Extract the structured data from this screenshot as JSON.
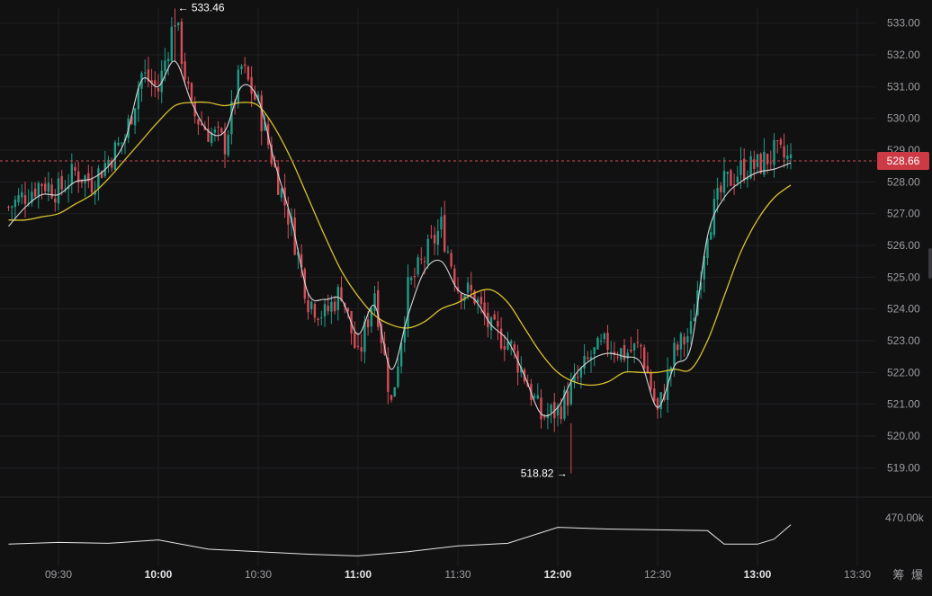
{
  "chart_data": {
    "type": "candlestick",
    "symbol": "",
    "title": "",
    "last_price": 528.66,
    "high_marker": {
      "value": 533.46,
      "time": "10:05",
      "label": "533.46"
    },
    "low_marker": {
      "value": 518.82,
      "time": "12:04",
      "label": "518.82"
    },
    "y_axis": {
      "min": 518.5,
      "max": 533.5,
      "ticks": [
        "533.00",
        "532.00",
        "531.00",
        "530.00",
        "529.00",
        "528.00",
        "527.00",
        "526.00",
        "525.00",
        "524.00",
        "523.00",
        "522.00",
        "521.00",
        "520.00",
        "519.00"
      ]
    },
    "x_axis": {
      "ticks": [
        {
          "time": "09:30",
          "bold": false
        },
        {
          "time": "10:00",
          "bold": true
        },
        {
          "time": "10:30",
          "bold": false
        },
        {
          "time": "11:00",
          "bold": true
        },
        {
          "time": "11:30",
          "bold": false
        },
        {
          "time": "12:00",
          "bold": true
        },
        {
          "time": "12:30",
          "bold": false
        },
        {
          "time": "13:00",
          "bold": true
        },
        {
          "time": "13:30",
          "bold": false
        }
      ]
    },
    "volume_axis": {
      "tick": "470.00k"
    },
    "series": [
      {
        "name": "",
        "kind": "price_path",
        "points": [
          {
            "t": "09:15",
            "v": 527.2
          },
          {
            "t": "09:20",
            "v": 527.6
          },
          {
            "t": "09:25",
            "v": 528.0
          },
          {
            "t": "09:30",
            "v": 527.7
          },
          {
            "t": "09:35",
            "v": 528.3
          },
          {
            "t": "09:40",
            "v": 528.0
          },
          {
            "t": "09:45",
            "v": 528.7
          },
          {
            "t": "09:50",
            "v": 529.4
          },
          {
            "t": "09:55",
            "v": 531.4
          },
          {
            "t": "10:00",
            "v": 530.9
          },
          {
            "t": "10:05",
            "v": 533.2
          },
          {
            "t": "10:10",
            "v": 530.2
          },
          {
            "t": "10:15",
            "v": 529.6
          },
          {
            "t": "10:20",
            "v": 529.2
          },
          {
            "t": "10:25",
            "v": 531.6
          },
          {
            "t": "10:30",
            "v": 530.4
          },
          {
            "t": "10:35",
            "v": 528.4
          },
          {
            "t": "10:40",
            "v": 526.6
          },
          {
            "t": "10:45",
            "v": 524.3
          },
          {
            "t": "10:50",
            "v": 523.8
          },
          {
            "t": "10:55",
            "v": 524.6
          },
          {
            "t": "11:00",
            "v": 522.4
          },
          {
            "t": "11:05",
            "v": 524.6
          },
          {
            "t": "11:10",
            "v": 521.0
          },
          {
            "t": "11:15",
            "v": 524.6
          },
          {
            "t": "11:20",
            "v": 525.6
          },
          {
            "t": "11:25",
            "v": 526.6
          },
          {
            "t": "11:30",
            "v": 524.7
          },
          {
            "t": "11:35",
            "v": 524.4
          },
          {
            "t": "11:40",
            "v": 523.3
          },
          {
            "t": "11:45",
            "v": 523.0
          },
          {
            "t": "11:50",
            "v": 521.9
          },
          {
            "t": "11:55",
            "v": 520.6
          },
          {
            "t": "12:00",
            "v": 520.8
          },
          {
            "t": "12:05",
            "v": 521.6
          },
          {
            "t": "12:10",
            "v": 522.5
          },
          {
            "t": "12:15",
            "v": 522.9
          },
          {
            "t": "12:20",
            "v": 522.6
          },
          {
            "t": "12:25",
            "v": 522.8
          },
          {
            "t": "12:30",
            "v": 520.7
          },
          {
            "t": "12:35",
            "v": 522.6
          },
          {
            "t": "12:40",
            "v": 523.3
          },
          {
            "t": "12:45",
            "v": 526.6
          },
          {
            "t": "12:50",
            "v": 527.9
          },
          {
            "t": "12:55",
            "v": 528.4
          },
          {
            "t": "13:00",
            "v": 528.5
          },
          {
            "t": "13:05",
            "v": 528.9
          },
          {
            "t": "13:10",
            "v": 528.66
          }
        ]
      },
      {
        "name": "",
        "kind": "moving_average_fast",
        "points": [
          {
            "t": "09:15",
            "v": 526.6
          },
          {
            "t": "09:20",
            "v": 527.2
          },
          {
            "t": "09:25",
            "v": 527.6
          },
          {
            "t": "09:30",
            "v": 527.6
          },
          {
            "t": "09:35",
            "v": 528.0
          },
          {
            "t": "09:40",
            "v": 528.1
          },
          {
            "t": "09:45",
            "v": 528.5
          },
          {
            "t": "09:50",
            "v": 529.3
          },
          {
            "t": "09:55",
            "v": 531.2
          },
          {
            "t": "10:00",
            "v": 531.0
          },
          {
            "t": "10:05",
            "v": 531.8
          },
          {
            "t": "10:10",
            "v": 530.5
          },
          {
            "t": "10:15",
            "v": 529.6
          },
          {
            "t": "10:20",
            "v": 529.6
          },
          {
            "t": "10:25",
            "v": 531.0
          },
          {
            "t": "10:30",
            "v": 530.6
          },
          {
            "t": "10:35",
            "v": 528.6
          },
          {
            "t": "10:40",
            "v": 526.8
          },
          {
            "t": "10:45",
            "v": 524.5
          },
          {
            "t": "10:50",
            "v": 524.3
          },
          {
            "t": "10:55",
            "v": 524.3
          },
          {
            "t": "11:00",
            "v": 523.2
          },
          {
            "t": "11:05",
            "v": 524.1
          },
          {
            "t": "11:10",
            "v": 522.1
          },
          {
            "t": "11:15",
            "v": 523.8
          },
          {
            "t": "11:20",
            "v": 525.2
          },
          {
            "t": "11:25",
            "v": 525.5
          },
          {
            "t": "11:30",
            "v": 524.6
          },
          {
            "t": "11:35",
            "v": 524.3
          },
          {
            "t": "11:40",
            "v": 523.5
          },
          {
            "t": "11:45",
            "v": 523.0
          },
          {
            "t": "11:50",
            "v": 521.9
          },
          {
            "t": "11:55",
            "v": 520.7
          },
          {
            "t": "12:00",
            "v": 520.9
          },
          {
            "t": "12:05",
            "v": 521.9
          },
          {
            "t": "12:10",
            "v": 522.4
          },
          {
            "t": "12:15",
            "v": 522.6
          },
          {
            "t": "12:20",
            "v": 522.5
          },
          {
            "t": "12:25",
            "v": 522.3
          },
          {
            "t": "12:30",
            "v": 520.9
          },
          {
            "t": "12:35",
            "v": 522.2
          },
          {
            "t": "12:40",
            "v": 522.8
          },
          {
            "t": "12:45",
            "v": 526.3
          },
          {
            "t": "12:50",
            "v": 527.5
          },
          {
            "t": "12:55",
            "v": 528.0
          },
          {
            "t": "13:00",
            "v": 528.3
          },
          {
            "t": "13:05",
            "v": 528.4
          },
          {
            "t": "13:10",
            "v": 528.6
          }
        ]
      },
      {
        "name": "",
        "kind": "moving_average_slow",
        "points": [
          {
            "t": "09:15",
            "v": 526.8
          },
          {
            "t": "09:20",
            "v": 526.8
          },
          {
            "t": "09:25",
            "v": 526.9
          },
          {
            "t": "09:30",
            "v": 527.0
          },
          {
            "t": "09:35",
            "v": 527.3
          },
          {
            "t": "09:40",
            "v": 527.6
          },
          {
            "t": "09:45",
            "v": 528.1
          },
          {
            "t": "09:50",
            "v": 528.7
          },
          {
            "t": "09:55",
            "v": 529.3
          },
          {
            "t": "10:00",
            "v": 529.9
          },
          {
            "t": "10:05",
            "v": 530.4
          },
          {
            "t": "10:10",
            "v": 530.5
          },
          {
            "t": "10:15",
            "v": 530.5
          },
          {
            "t": "10:20",
            "v": 530.4
          },
          {
            "t": "10:25",
            "v": 530.5
          },
          {
            "t": "10:30",
            "v": 530.4
          },
          {
            "t": "10:35",
            "v": 529.7
          },
          {
            "t": "10:40",
            "v": 528.7
          },
          {
            "t": "10:45",
            "v": 527.5
          },
          {
            "t": "10:50",
            "v": 526.3
          },
          {
            "t": "10:55",
            "v": 525.2
          },
          {
            "t": "11:00",
            "v": 524.4
          },
          {
            "t": "11:05",
            "v": 523.8
          },
          {
            "t": "11:10",
            "v": 523.5
          },
          {
            "t": "11:15",
            "v": 523.4
          },
          {
            "t": "11:20",
            "v": 523.6
          },
          {
            "t": "11:25",
            "v": 524.0
          },
          {
            "t": "11:30",
            "v": 524.2
          },
          {
            "t": "11:35",
            "v": 524.5
          },
          {
            "t": "11:40",
            "v": 524.6
          },
          {
            "t": "11:45",
            "v": 524.2
          },
          {
            "t": "11:50",
            "v": 523.4
          },
          {
            "t": "11:55",
            "v": 522.6
          },
          {
            "t": "12:00",
            "v": 522.0
          },
          {
            "t": "12:05",
            "v": 521.7
          },
          {
            "t": "12:10",
            "v": 521.6
          },
          {
            "t": "12:15",
            "v": 521.7
          },
          {
            "t": "12:20",
            "v": 522.0
          },
          {
            "t": "12:25",
            "v": 522.0
          },
          {
            "t": "12:30",
            "v": 522.0
          },
          {
            "t": "12:35",
            "v": 522.1
          },
          {
            "t": "12:40",
            "v": 522.1
          },
          {
            "t": "12:45",
            "v": 523.0
          },
          {
            "t": "12:50",
            "v": 524.4
          },
          {
            "t": "12:55",
            "v": 525.8
          },
          {
            "t": "13:00",
            "v": 526.8
          },
          {
            "t": "13:05",
            "v": 527.5
          },
          {
            "t": "13:10",
            "v": 527.9
          }
        ]
      },
      {
        "name": "",
        "kind": "volume_line",
        "points": [
          {
            "t": "09:15",
            "v": 465.8
          },
          {
            "t": "09:30",
            "v": 466.0
          },
          {
            "t": "09:45",
            "v": 465.9
          },
          {
            "t": "10:00",
            "v": 466.3
          },
          {
            "t": "10:15",
            "v": 465.2
          },
          {
            "t": "10:30",
            "v": 464.9
          },
          {
            "t": "10:45",
            "v": 464.6
          },
          {
            "t": "11:00",
            "v": 464.4
          },
          {
            "t": "11:15",
            "v": 464.9
          },
          {
            "t": "11:30",
            "v": 465.6
          },
          {
            "t": "11:45",
            "v": 465.9
          },
          {
            "t": "12:00",
            "v": 467.8
          },
          {
            "t": "12:15",
            "v": 467.6
          },
          {
            "t": "12:30",
            "v": 467.5
          },
          {
            "t": "12:45",
            "v": 467.4
          },
          {
            "t": "12:50",
            "v": 465.8
          },
          {
            "t": "13:00",
            "v": 465.8
          },
          {
            "t": "13:05",
            "v": 466.4
          },
          {
            "t": "13:10",
            "v": 468.1
          }
        ]
      }
    ],
    "colors": {
      "up": "#1f9b86",
      "down": "#d64d57",
      "price_line": "#d6d6d9",
      "ma_slow": "#d9c22d",
      "last_price_line": "#d64d57",
      "grid": "#1f1f22"
    }
  },
  "footer": {
    "mark": "筹 爆"
  }
}
